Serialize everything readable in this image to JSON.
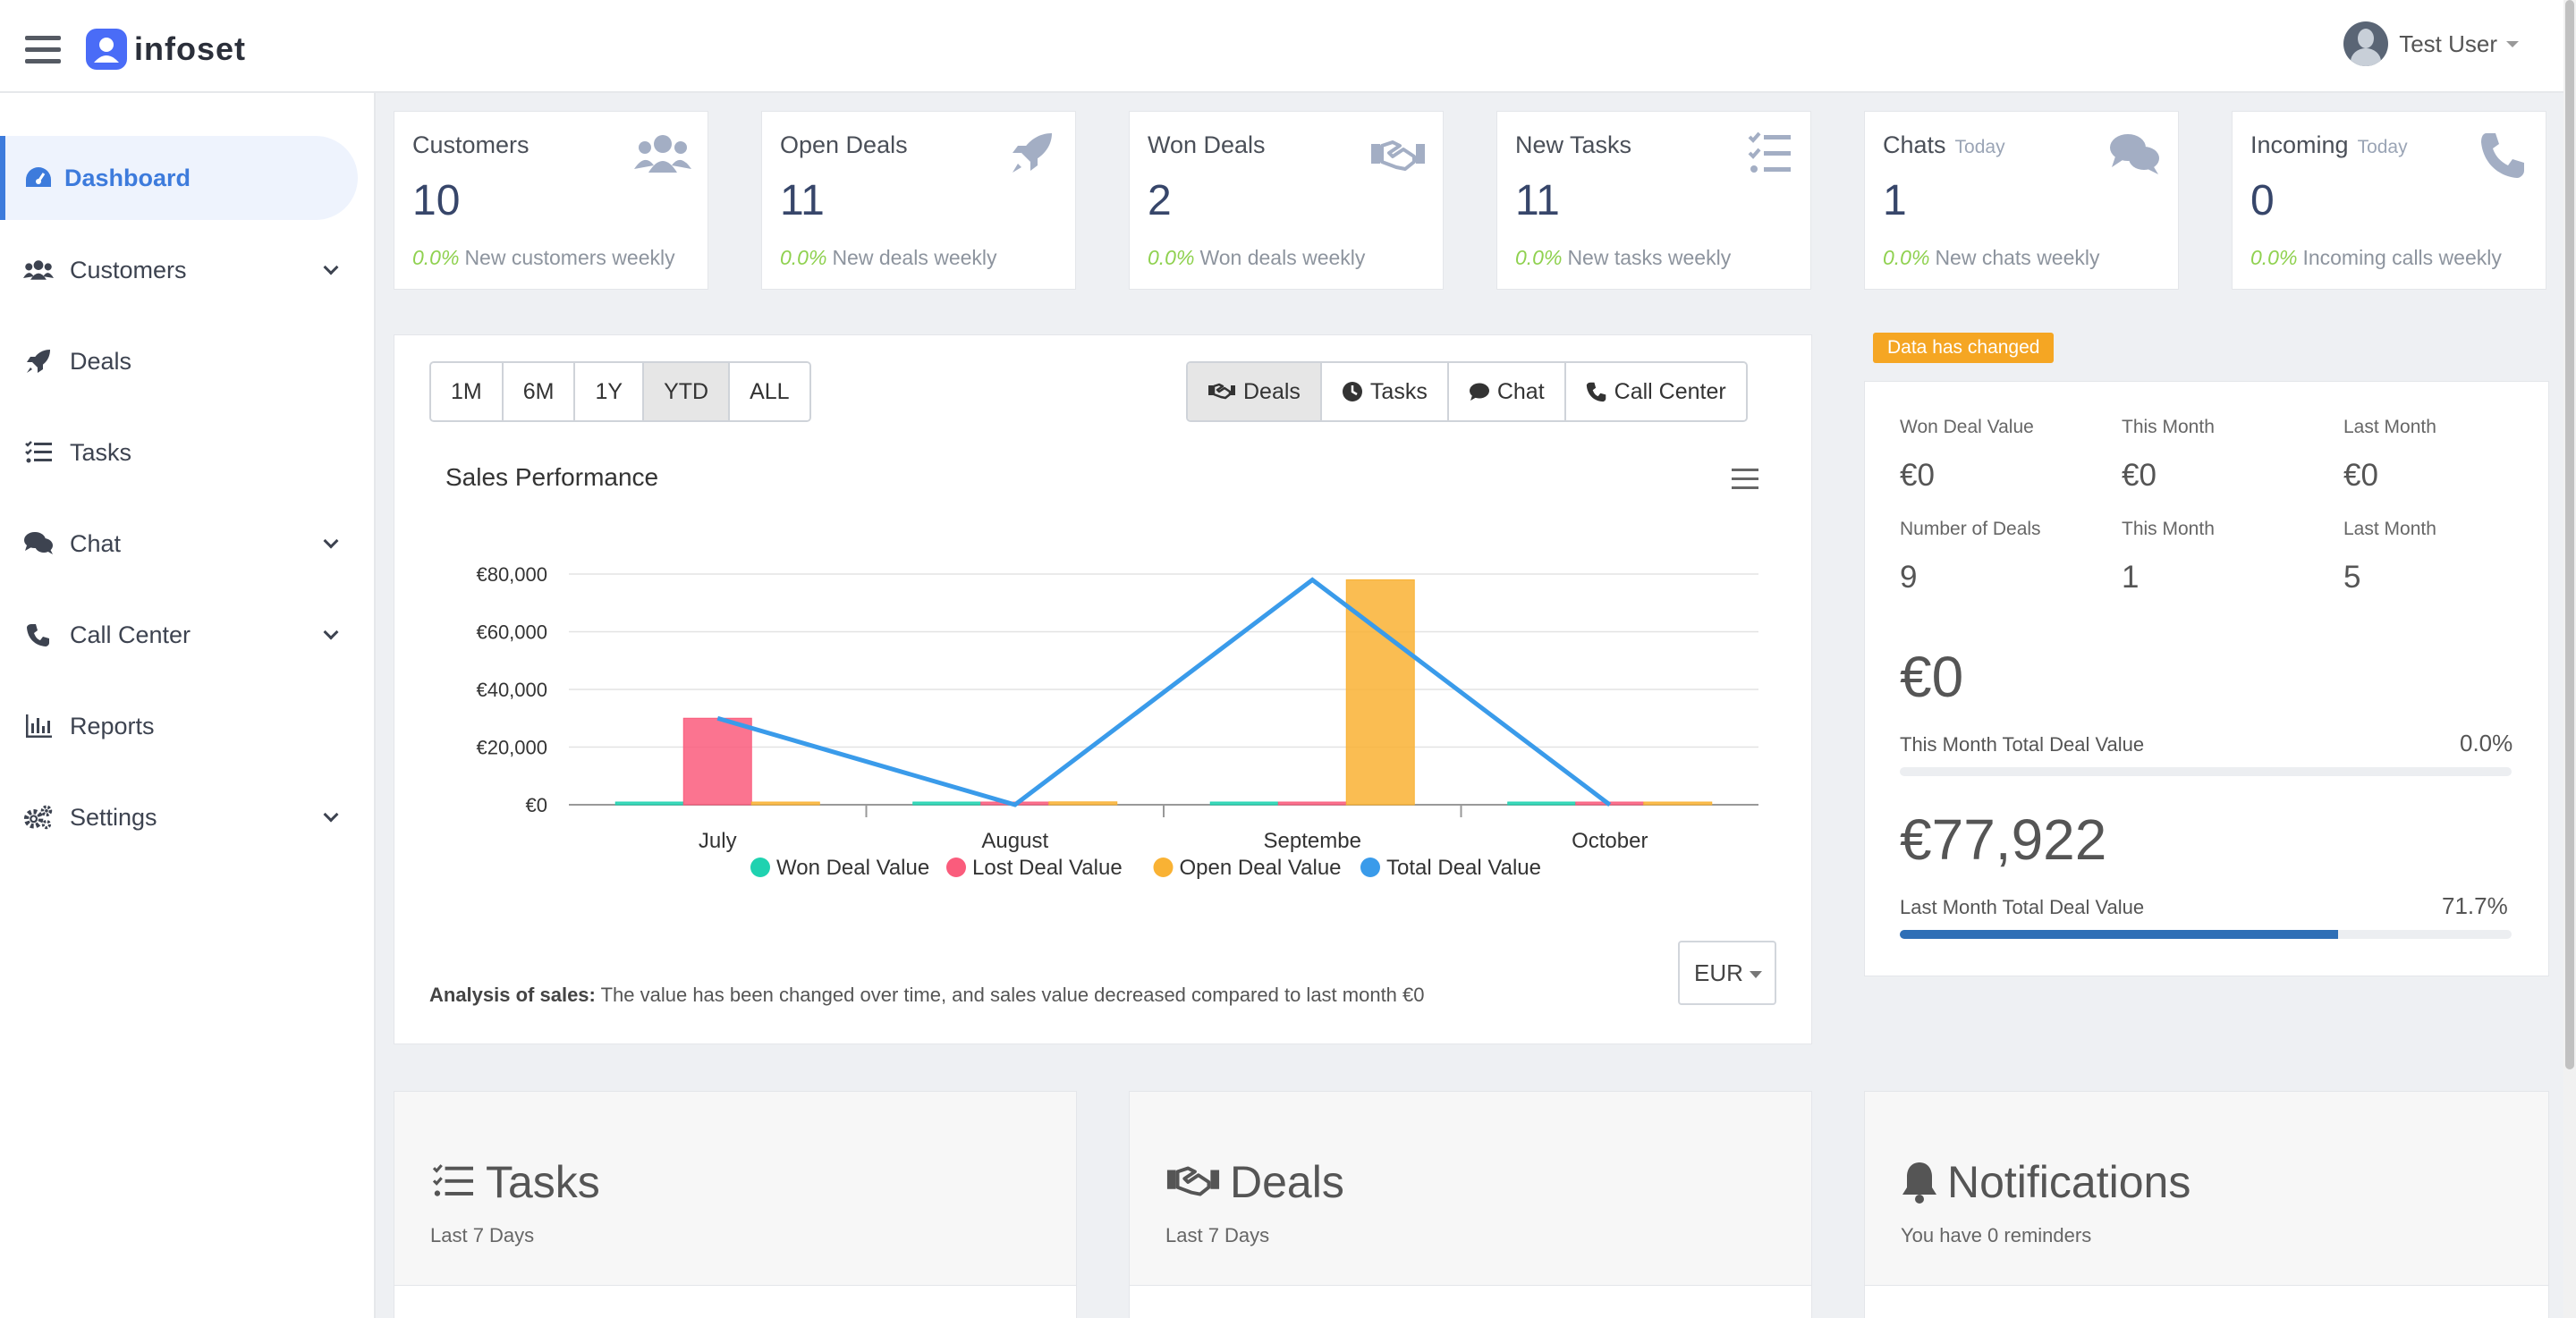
{
  "app": {
    "name": "infoset",
    "user_name": "Test User"
  },
  "sidebar": {
    "items": [
      {
        "label": "Dashboard",
        "icon": "dashboard-icon",
        "active": true,
        "expandable": false
      },
      {
        "label": "Customers",
        "icon": "users-icon",
        "active": false,
        "expandable": true
      },
      {
        "label": "Deals",
        "icon": "rocket-icon",
        "active": false,
        "expandable": false
      },
      {
        "label": "Tasks",
        "icon": "tasks-icon",
        "active": false,
        "expandable": false
      },
      {
        "label": "Chat",
        "icon": "chat-icon",
        "active": false,
        "expandable": true
      },
      {
        "label": "Call Center",
        "icon": "phone-icon",
        "active": false,
        "expandable": true
      },
      {
        "label": "Reports",
        "icon": "bar-chart-icon",
        "active": false,
        "expandable": false
      },
      {
        "label": "Settings",
        "icon": "gears-icon",
        "active": false,
        "expandable": true
      }
    ]
  },
  "stats": [
    {
      "title": "Customers",
      "today": "",
      "value": "10",
      "pct": "0.0%",
      "sub": "New customers weekly",
      "icon": "users-icon"
    },
    {
      "title": "Open Deals",
      "today": "",
      "value": "11",
      "pct": "0.0%",
      "sub": "New deals weekly",
      "icon": "rocket-icon"
    },
    {
      "title": "Won Deals",
      "today": "",
      "value": "2",
      "pct": "0.0%",
      "sub": "Won deals weekly",
      "icon": "handshake-icon"
    },
    {
      "title": "New Tasks",
      "today": "",
      "value": "11",
      "pct": "0.0%",
      "sub": "New tasks weekly",
      "icon": "tasks-icon"
    },
    {
      "title": "Chats",
      "today": "Today",
      "value": "1",
      "pct": "0.0%",
      "sub": "New chats weekly",
      "icon": "chat-icon"
    },
    {
      "title": "Incoming",
      "today": "Today",
      "value": "0",
      "pct": "0.0%",
      "sub": "Incoming calls weekly",
      "icon": "phone-icon"
    }
  ],
  "range_buttons": [
    "1M",
    "6M",
    "1Y",
    "YTD",
    "ALL"
  ],
  "range_selected": "YTD",
  "mode_buttons": [
    {
      "label": "Deals",
      "icon": "handshake-icon"
    },
    {
      "label": "Tasks",
      "icon": "clock-icon"
    },
    {
      "label": "Chat",
      "icon": "comment-icon"
    },
    {
      "label": "Call Center",
      "icon": "phone-icon"
    }
  ],
  "mode_selected": "Deals",
  "analysis": {
    "bold": "Analysis of sales:",
    "text": "The value has been changed over time, and sales value decreased compared to last month €0"
  },
  "currency": "EUR",
  "chart_data": {
    "type": "bar",
    "title": "Sales Performance",
    "categories": [
      "July",
      "August",
      "Septembe",
      "October"
    ],
    "y_ticks": [
      "€0",
      "€20,000",
      "€40,000",
      "€60,000",
      "€80,000"
    ],
    "ylim": [
      0,
      80000
    ],
    "series": [
      {
        "name": "Won Deal Value",
        "type": "bar",
        "color": "#1fd2b0",
        "values": [
          0,
          0,
          0,
          0
        ]
      },
      {
        "name": "Lost Deal Value",
        "type": "bar",
        "color": "#fa5c7c",
        "values": [
          30000,
          0,
          0,
          0
        ]
      },
      {
        "name": "Open Deal Value",
        "type": "bar",
        "color": "#f9b234",
        "values": [
          0,
          1000,
          78000,
          0
        ]
      },
      {
        "name": "Total Deal Value",
        "type": "line",
        "color": "#3a9bea",
        "values": [
          30000,
          0,
          78000,
          0
        ]
      }
    ],
    "legend": "bottom",
    "grid": true
  },
  "summary": {
    "badge": "Data has changed",
    "rows": [
      [
        {
          "label": "Won Deal Value",
          "value": "€0"
        },
        {
          "label": "This Month",
          "value": "€0"
        },
        {
          "label": "Last Month",
          "value": "€0"
        }
      ],
      [
        {
          "label": "Number of Deals",
          "value": "9"
        },
        {
          "label": "This Month",
          "value": "1"
        },
        {
          "label": "Last Month",
          "value": "5"
        }
      ]
    ],
    "this_month": {
      "value": "€0",
      "label": "This Month Total Deal Value",
      "pct": "0.0%",
      "fraction": 0.0
    },
    "last_month": {
      "value": "€77,922",
      "label": "Last Month Total Deal Value",
      "pct": "71.7%",
      "fraction": 0.717
    }
  },
  "bottom": [
    {
      "title": "Tasks",
      "sub": "Last 7 Days",
      "icon": "tasks-icon"
    },
    {
      "title": "Deals",
      "sub": "Last 7 Days",
      "icon": "handshake-icon"
    },
    {
      "title": "Notifications",
      "sub": "You have 0 reminders",
      "icon": "bell-icon"
    }
  ]
}
